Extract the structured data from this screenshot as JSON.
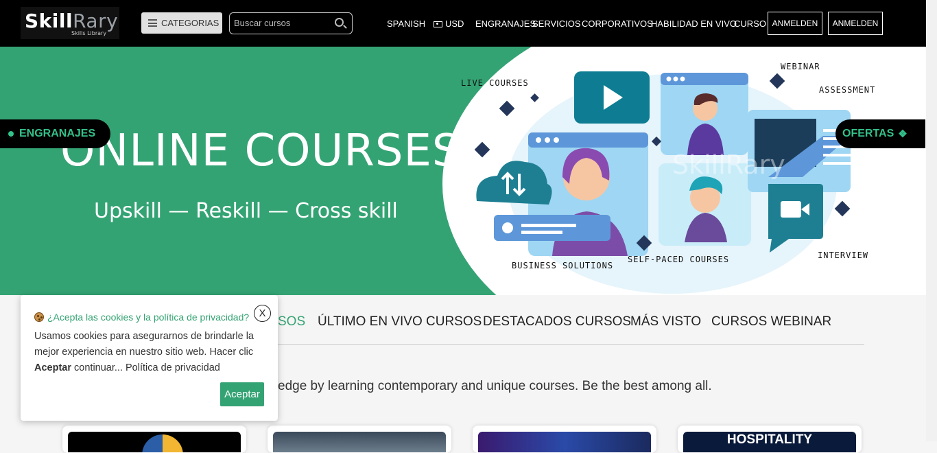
{
  "header": {
    "logo_main": "Skill",
    "logo_accent": "Rary",
    "logo_tagline": "Skills Library",
    "categories_label": "CATEGORIAS",
    "search_placeholder": "Buscar cursos",
    "nav": [
      "SPANISH",
      "USD",
      "ENGRANAJES",
      "SERVICIOS",
      "CORPORATIVOS",
      "HABILIDAD EN VIVO",
      "CURSO"
    ],
    "login_1": "ANMELDEN",
    "login_2": "ANMELDEN"
  },
  "hero": {
    "title": "ONLINE COURSES",
    "subtitle": "Upskill — Reskill — Cross skill",
    "labels": {
      "live": "LIVE COURSES",
      "webinar": "WEBINAR",
      "assessment": "ASSESSMENT",
      "business": "BUSINESS SOLUTIONS",
      "self_paced": "SELF-PACED COURSES",
      "interview": "INTERVIEW"
    },
    "watermark": "SkillRary",
    "pill_left": "ENGRANAJES",
    "pill_right": "OFERTAS"
  },
  "tabs": [
    "SOS",
    "ÚLTIMO EN VIVO CURSOS",
    "DESTACADOS CURSOS",
    "MÁS VISTO",
    "CURSOS WEBINAR"
  ],
  "tagline": "edge by learning contemporary and unique courses. Be the best among all.",
  "cards": {
    "card4_text": "HOSPITALITY"
  },
  "cookie": {
    "title": "¿Acepta las cookies y la política de privacidad?",
    "close": "X",
    "body_1": "Usamos cookies para asegurarnos de brindarle la mejor experiencia en nuestro sitio web. Hacer clic",
    "body_bold": "Aceptar",
    "body_2": "continuar... Política de privacidad",
    "accept": "Aceptar"
  },
  "colors": {
    "brand_green": "#34a373",
    "dark": "#000000",
    "navy": "#24375a"
  }
}
